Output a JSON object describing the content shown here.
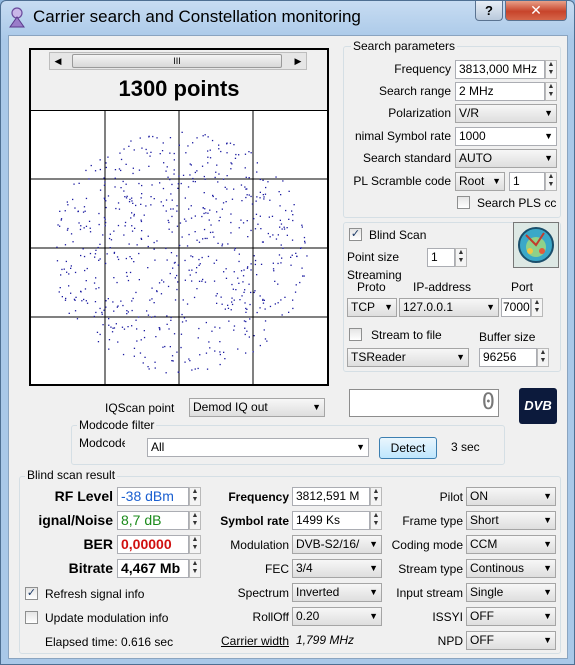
{
  "window": {
    "title": "Carrier search and Constellation monitoring",
    "help_label": "?",
    "close_label": "✕"
  },
  "constellation": {
    "points_label": "1300 points",
    "scroll_thumb": "III",
    "dot_color": "#1a1aa0",
    "seed": 1300
  },
  "iqscan": {
    "label": "IQScan point",
    "value": "Demod IQ out"
  },
  "modcode": {
    "group": "Modcode filter",
    "label": "Modcode",
    "value": "All",
    "detect": "Detect",
    "seconds": "3 sec"
  },
  "readout": {
    "value": "0"
  },
  "logo": {
    "text": "DVB"
  },
  "search": {
    "group": "Search parameters",
    "frequency_label": "Frequency",
    "frequency": "3813,000 MHz",
    "range_label": "Search range",
    "range": "2 MHz",
    "polarization_label": "Polarization",
    "polarization": "V/R",
    "symbol_label": "nimal Symbol rate",
    "symbol": "1000",
    "standard_label": "Search standard",
    "standard": "AUTO",
    "pls_label": "PL Scramble code",
    "pls_type": "Root",
    "pls_value": "1",
    "search_pls_label": "Search PLS cc"
  },
  "blind": {
    "label": "Blind Scan",
    "checked": true,
    "point_size_label": "Point size",
    "point_size": "1"
  },
  "streaming": {
    "group": "Streaming",
    "proto_header": "Proto",
    "ip_header": "IP-address",
    "port_header": "Port",
    "proto": "TCP",
    "ip": "127.0.0.1",
    "port": "7000",
    "stream_to_file_label": "Stream to file",
    "buffer_label": "Buffer size",
    "buffer": "96256",
    "reader": "TSReader"
  },
  "result": {
    "group": "Blind scan result",
    "rf_label": "RF Level",
    "rf": "-38 dBm",
    "rf_color": "#1a5fd0",
    "sn_label": "ignal/Noise",
    "sn": "8,7 dB",
    "sn_color": "#1a8a1a",
    "ber_label": "BER",
    "ber": "0,00000",
    "ber_color": "#d01010",
    "bitrate_label": "Bitrate",
    "bitrate": "4,467 Mb",
    "freq_label": "Frequency",
    "freq": "3812,591 M",
    "symbol_label": "Symbol rate",
    "symbol": "1499 Ks",
    "modulation_label": "Modulation",
    "modulation": "DVB-S2/16/",
    "fec_label": "FEC",
    "fec": "3/4",
    "spectrum_label": "Spectrum",
    "spectrum": "Inverted",
    "rolloff_label": "RollOff",
    "rolloff": "0.20",
    "carrier_label": "Carrier width",
    "carrier": "1,799 MHz",
    "pilot_label": "Pilot",
    "pilot": "ON",
    "frame_label": "Frame type",
    "frame": "Short",
    "coding_label": "Coding mode",
    "coding": "CCM",
    "stream_type_label": "Stream type",
    "stream_type": "Continous",
    "input_label": "Input stream",
    "input": "Single",
    "issyi_label": "ISSYI",
    "issyi": "OFF",
    "npd_label": "NPD",
    "npd": "OFF",
    "refresh_label": "Refresh signal info",
    "refresh_checked": true,
    "update_label": "Update modulation info",
    "update_checked": false,
    "elapsed": "Elapsed time: 0.616 sec"
  }
}
